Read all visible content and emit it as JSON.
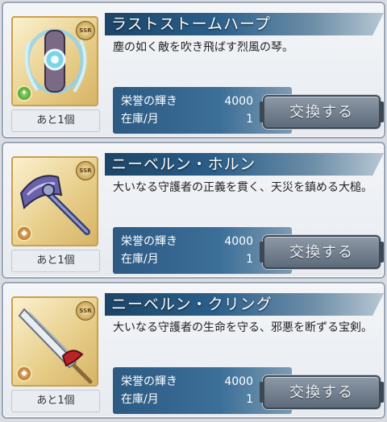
{
  "items": [
    {
      "name": "ラストストームハープ",
      "description": "塵の如く敵を吹き飛ばす烈風の琴。",
      "rarity": "SSR",
      "element": "wind",
      "remaining": "あと1個",
      "cost_label": "栄誉の輝き",
      "cost_value": "4000",
      "stock_label": "在庫/月",
      "stock_value": "1",
      "button_label": "交換する"
    },
    {
      "name": "ニーベルン・ホルン",
      "description": "大いなる守護者の正義を貫く、天災を鎮める大槌。",
      "rarity": "SSR",
      "element": "earth",
      "remaining": "あと1個",
      "cost_label": "栄誉の輝き",
      "cost_value": "4000",
      "stock_label": "在庫/月",
      "stock_value": "1",
      "button_label": "交換する"
    },
    {
      "name": "ニーベルン・クリング",
      "description": "大いなる守護者の生命を守る、邪悪を断ずる宝剣。",
      "rarity": "SSR",
      "element": "earth",
      "remaining": "あと1個",
      "cost_label": "栄誉の輝き",
      "cost_value": "4000",
      "stock_label": "在庫/月",
      "stock_value": "1",
      "button_label": "交換する"
    }
  ]
}
